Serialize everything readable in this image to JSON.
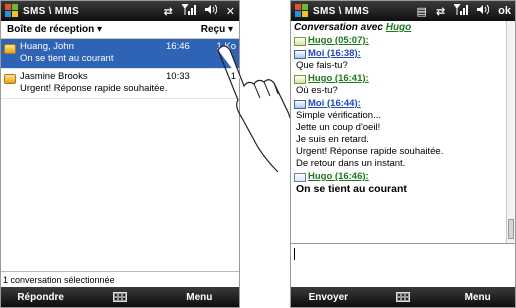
{
  "left": {
    "app_title": "SMS \\ MMS",
    "close_label": "✕",
    "folder": "Boîte de réception",
    "sort": "Reçu",
    "messages": [
      {
        "from": "Huang, John",
        "time": "16:46",
        "size": "1 Ko",
        "preview": "On se tient au courant",
        "selected": true
      },
      {
        "from": "Jasmine Brooks",
        "time": "10:33",
        "size": "1",
        "preview": "Urgent! Réponse rapide souhaitée.",
        "selected": false
      }
    ],
    "status_text": "1 conversation sélectionnée",
    "softkey_left": "Répondre",
    "softkey_right": "Menu"
  },
  "right": {
    "app_title": "SMS \\ MMS",
    "ok_label": "ok",
    "conversation_prefix": "Conversation avec",
    "contact": "Hugo",
    "entries": [
      {
        "sender": "Hugo (05:07):",
        "kind": "hugo",
        "lines": []
      },
      {
        "sender": "Moi (16:38):",
        "kind": "moi",
        "lines": [
          "Que fais-tu?"
        ]
      },
      {
        "sender": "Hugo (16:41):",
        "kind": "hugo",
        "lines": [
          "Où es-tu?"
        ]
      },
      {
        "sender": "Moi (16:44):",
        "kind": "moi",
        "lines": [
          "Simple vérification...",
          "Jette un coup d'oeil!",
          "Je suis en retard.",
          "Urgent! Réponse rapide souhaitée.",
          "De retour dans un instant."
        ]
      },
      {
        "sender": "Hugo (16:46):",
        "kind": "new",
        "lines": [
          "On se tient au courant"
        ]
      }
    ],
    "softkey_left": "Envoyer",
    "softkey_right": "Menu"
  },
  "icons": {
    "start": "windows-flag-icon",
    "sync": "sync-icon",
    "signal": "signal-icon",
    "volume": "volume-icon",
    "keyboard": "keyboard-icon",
    "envelope": "envelope-icon"
  }
}
